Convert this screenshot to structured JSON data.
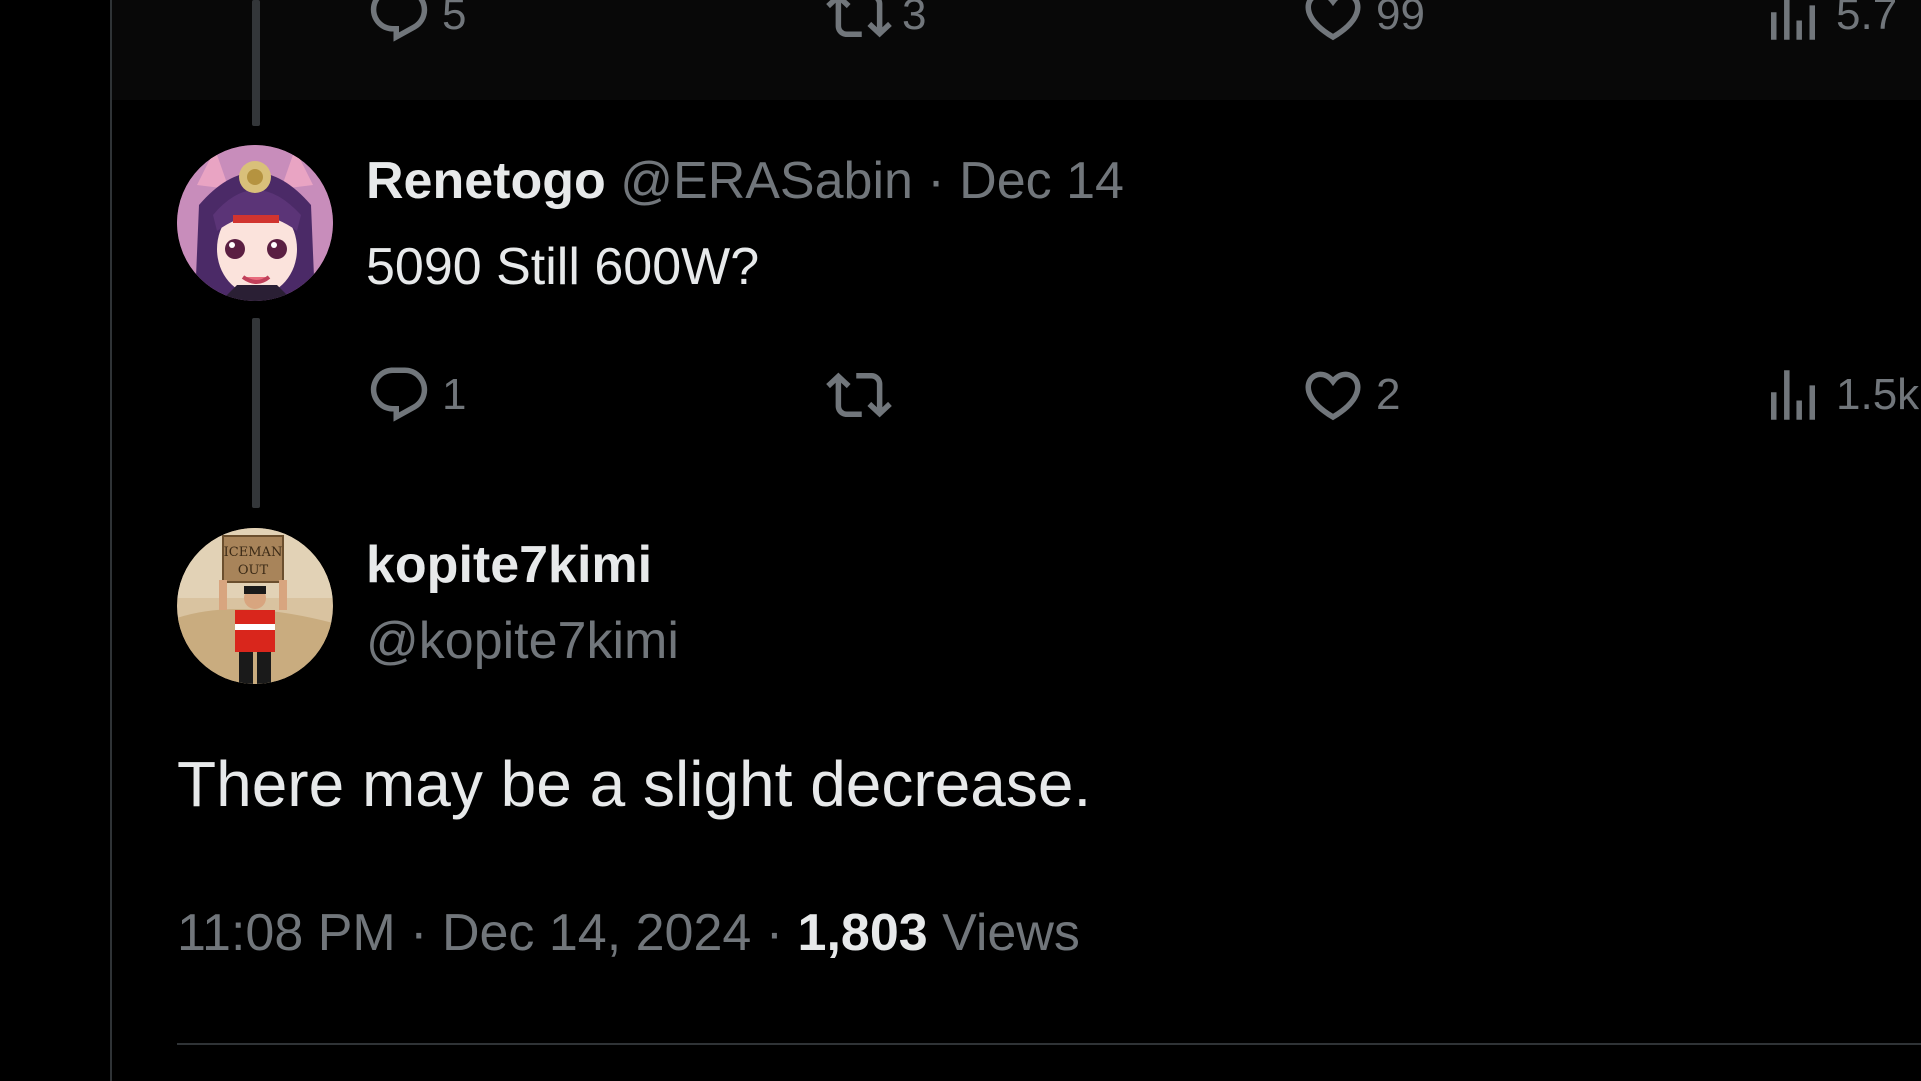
{
  "prev_tweet": {
    "actions": {
      "replies": "5",
      "reposts": "3",
      "likes": "99",
      "views": "5.7"
    }
  },
  "reply_tweet": {
    "display_name": "Renetogo",
    "handle": "@ERASabin",
    "separator": "·",
    "date": "Dec 14",
    "text": "5090 Still 600W?",
    "actions": {
      "replies": "1",
      "reposts": "",
      "likes": "2",
      "views": "1.5k"
    }
  },
  "main_tweet": {
    "display_name": "kopite7kimi",
    "handle": "@kopite7kimi",
    "text": "There may be a slight decrease.",
    "time": "11:08 PM",
    "separator": "·",
    "date": "Dec 14, 2024",
    "views_count": "1,803",
    "views_label": "Views",
    "avatar_sign_line1": "ICEMAN",
    "avatar_sign_line2": "OUT"
  },
  "icons": [
    "reply-icon",
    "repost-icon",
    "like-icon",
    "views-icon"
  ],
  "colors": {
    "background": "#000000",
    "text": "#e7e9ea",
    "muted": "#71767b",
    "border": "#2f3336"
  }
}
